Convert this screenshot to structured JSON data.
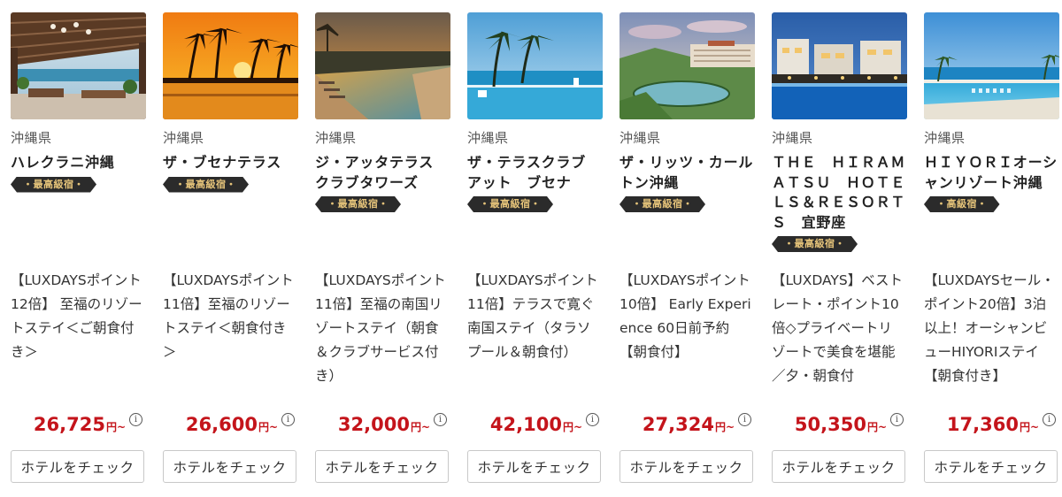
{
  "hotels": [
    {
      "image": "resort-lobby-ocean-view-photo",
      "prefecture": "沖縄県",
      "name": "ハレクラニ沖縄",
      "badge": "・最高級宿・",
      "plan": "【LUXDAYSポイント12倍】 至福のリゾートステイ＜ご朝食付き＞",
      "price": "26,725",
      "price_suffix": "円~",
      "info_icon": "info-icon",
      "button": "ホテルをチェック"
    },
    {
      "image": "sunset-palm-pool-photo",
      "prefecture": "沖縄県",
      "name": "ザ・ブセナテラス",
      "badge": "・最高級宿・",
      "plan": "【LUXDAYSポイント11倍】至福のリゾートステイ＜朝食付き＞",
      "price": "26,600",
      "price_suffix": "円~",
      "info_icon": "info-icon",
      "button": "ホテルをチェック"
    },
    {
      "image": "sunset-infinity-pool-photo",
      "prefecture": "沖縄県",
      "name": "ジ・アッタテラス　クラブタワーズ",
      "badge": "・最高級宿・",
      "plan": "【LUXDAYSポイント11倍】至福の南国リゾートステイ（朝食＆クラブサービス付き）",
      "price": "32,000",
      "price_suffix": "円~",
      "info_icon": "info-icon",
      "button": "ホテルをチェック"
    },
    {
      "image": "palm-infinity-pool-sea-photo",
      "prefecture": "沖縄県",
      "name": "ザ・テラスクラブ　アット　ブセナ",
      "badge": "・最高級宿・",
      "plan": "【LUXDAYSポイント11倍】テラスで寛ぐ南国ステイ（タラソプール＆朝食付）",
      "price": "42,100",
      "price_suffix": "円~",
      "info_icon": "info-icon",
      "button": "ホテルをチェック"
    },
    {
      "image": "golf-course-hotel-photo",
      "prefecture": "沖縄県",
      "name": "ザ・リッツ・カールトン沖縄",
      "badge": "・最高級宿・",
      "plan": "【LUXDAYSポイント10倍】 Early Experience 60日前予約【朝食付】",
      "price": "27,324",
      "price_suffix": "円~",
      "info_icon": "info-icon",
      "button": "ホテルをチェック"
    },
    {
      "image": "night-pool-resort-photo",
      "prefecture": "沖縄県",
      "name": "ＴＨＥ　ＨＩＲＡＭＡＴＳＵ　ＨＯＴＥＬＳ＆ＲＥＳＯＲＴＳ　宜野座",
      "badge": "・最高級宿・",
      "plan": "【LUXDAYS】ベストレート・ポイント10倍◇プライベートリゾートで美食を堪能／夕・朝食付",
      "price": "50,350",
      "price_suffix": "円~",
      "info_icon": "info-icon",
      "button": "ホテルをチェック"
    },
    {
      "image": "hiyori-ocean-pool-photo",
      "prefecture": "沖縄県",
      "name": "ＨＩＹＯＲＩオーシャンリゾート沖縄",
      "badge": "・高級宿・",
      "plan": "【LUXDAYSセール・ポイント20倍】3泊以上！オーシャンビューHIYORIステイ【朝食付き】",
      "price": "17,360",
      "price_suffix": "円~",
      "info_icon": "info-icon",
      "button": "ホテルをチェック"
    }
  ],
  "colors": {
    "price": "#c4141b",
    "badge_bg": "#2b2b2b",
    "badge_text": "#e6c47a",
    "button_border": "#c8c8c8"
  }
}
